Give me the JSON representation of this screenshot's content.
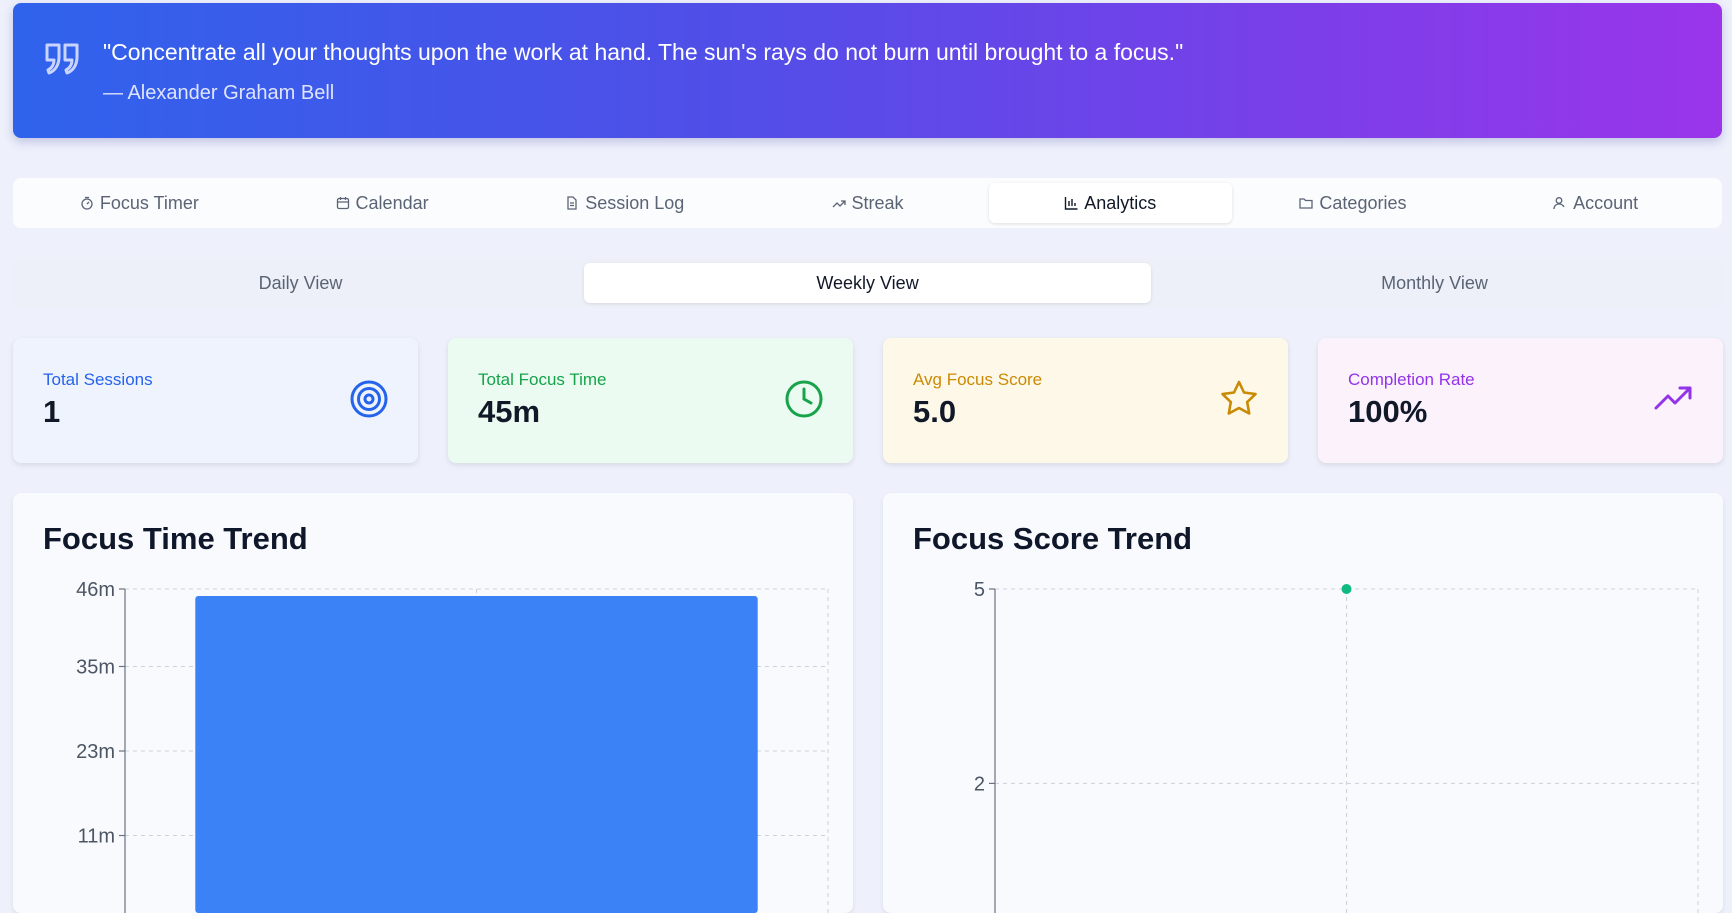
{
  "quote": {
    "text": "\"Concentrate all your thoughts upon the work at hand. The sun's rays do not burn until brought to a focus.\"",
    "author": "— Alexander Graham Bell",
    "icon": "quote-icon"
  },
  "main_tabs": [
    {
      "label": "Focus Timer",
      "icon": "timer-icon",
      "active": false
    },
    {
      "label": "Calendar",
      "icon": "calendar-icon",
      "active": false
    },
    {
      "label": "Session Log",
      "icon": "document-icon",
      "active": false
    },
    {
      "label": "Streak",
      "icon": "trend-icon",
      "active": false
    },
    {
      "label": "Analytics",
      "icon": "bar-chart-icon",
      "active": true
    },
    {
      "label": "Categories",
      "icon": "folder-icon",
      "active": false
    },
    {
      "label": "Account",
      "icon": "user-icon",
      "active": false
    }
  ],
  "view_tabs": [
    {
      "label": "Daily View",
      "active": false
    },
    {
      "label": "Weekly View",
      "active": true
    },
    {
      "label": "Monthly View",
      "active": false
    }
  ],
  "stats": [
    {
      "label": "Total Sessions",
      "value": "1",
      "icon": "target-icon",
      "color": "#2563eb",
      "bg": "#eff3fd"
    },
    {
      "label": "Total Focus Time",
      "value": "45m",
      "icon": "clock-icon",
      "color": "#16a34a",
      "bg": "#ecfbf1"
    },
    {
      "label": "Avg Focus Score",
      "value": "5.0",
      "icon": "star-icon",
      "color": "#ca8a04",
      "bg": "#fef8e9"
    },
    {
      "label": "Completion Rate",
      "value": "100%",
      "icon": "trending-up-icon",
      "color": "#9333ea",
      "bg": "#fbf2fb"
    }
  ],
  "charts": {
    "focus_time_title": "Focus Time Trend",
    "focus_score_title": "Focus Score Trend"
  },
  "chart_data": [
    {
      "type": "bar",
      "title": "Focus Time Trend",
      "categories": [
        ""
      ],
      "values": [
        45
      ],
      "ylim": [
        0,
        46
      ],
      "y_ticks": [
        "46m",
        "35m",
        "23m",
        "11m"
      ],
      "y_tick_values": [
        46,
        35,
        23,
        11
      ],
      "grid": true,
      "bar_color": "#3b82f6"
    },
    {
      "type": "scatter",
      "title": "Focus Score Trend",
      "x": [
        ""
      ],
      "y": [
        5
      ],
      "ylim": [
        0,
        5
      ],
      "y_ticks": [
        "5",
        "2"
      ],
      "y_tick_values": [
        5,
        2
      ],
      "grid": true,
      "point_color": "#10b981"
    }
  ]
}
